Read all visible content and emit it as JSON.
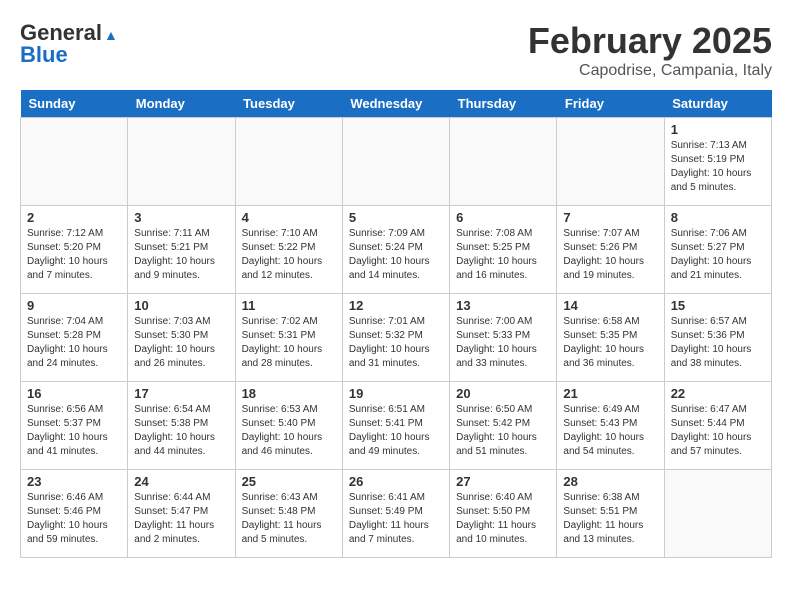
{
  "header": {
    "logo_general": "General",
    "logo_blue": "Blue",
    "title": "February 2025",
    "location": "Capodrise, Campania, Italy"
  },
  "days_of_week": [
    "Sunday",
    "Monday",
    "Tuesday",
    "Wednesday",
    "Thursday",
    "Friday",
    "Saturday"
  ],
  "weeks": [
    [
      {
        "num": "",
        "info": ""
      },
      {
        "num": "",
        "info": ""
      },
      {
        "num": "",
        "info": ""
      },
      {
        "num": "",
        "info": ""
      },
      {
        "num": "",
        "info": ""
      },
      {
        "num": "",
        "info": ""
      },
      {
        "num": "1",
        "info": "Sunrise: 7:13 AM\nSunset: 5:19 PM\nDaylight: 10 hours and 5 minutes."
      }
    ],
    [
      {
        "num": "2",
        "info": "Sunrise: 7:12 AM\nSunset: 5:20 PM\nDaylight: 10 hours and 7 minutes."
      },
      {
        "num": "3",
        "info": "Sunrise: 7:11 AM\nSunset: 5:21 PM\nDaylight: 10 hours and 9 minutes."
      },
      {
        "num": "4",
        "info": "Sunrise: 7:10 AM\nSunset: 5:22 PM\nDaylight: 10 hours and 12 minutes."
      },
      {
        "num": "5",
        "info": "Sunrise: 7:09 AM\nSunset: 5:24 PM\nDaylight: 10 hours and 14 minutes."
      },
      {
        "num": "6",
        "info": "Sunrise: 7:08 AM\nSunset: 5:25 PM\nDaylight: 10 hours and 16 minutes."
      },
      {
        "num": "7",
        "info": "Sunrise: 7:07 AM\nSunset: 5:26 PM\nDaylight: 10 hours and 19 minutes."
      },
      {
        "num": "8",
        "info": "Sunrise: 7:06 AM\nSunset: 5:27 PM\nDaylight: 10 hours and 21 minutes."
      }
    ],
    [
      {
        "num": "9",
        "info": "Sunrise: 7:04 AM\nSunset: 5:28 PM\nDaylight: 10 hours and 24 minutes."
      },
      {
        "num": "10",
        "info": "Sunrise: 7:03 AM\nSunset: 5:30 PM\nDaylight: 10 hours and 26 minutes."
      },
      {
        "num": "11",
        "info": "Sunrise: 7:02 AM\nSunset: 5:31 PM\nDaylight: 10 hours and 28 minutes."
      },
      {
        "num": "12",
        "info": "Sunrise: 7:01 AM\nSunset: 5:32 PM\nDaylight: 10 hours and 31 minutes."
      },
      {
        "num": "13",
        "info": "Sunrise: 7:00 AM\nSunset: 5:33 PM\nDaylight: 10 hours and 33 minutes."
      },
      {
        "num": "14",
        "info": "Sunrise: 6:58 AM\nSunset: 5:35 PM\nDaylight: 10 hours and 36 minutes."
      },
      {
        "num": "15",
        "info": "Sunrise: 6:57 AM\nSunset: 5:36 PM\nDaylight: 10 hours and 38 minutes."
      }
    ],
    [
      {
        "num": "16",
        "info": "Sunrise: 6:56 AM\nSunset: 5:37 PM\nDaylight: 10 hours and 41 minutes."
      },
      {
        "num": "17",
        "info": "Sunrise: 6:54 AM\nSunset: 5:38 PM\nDaylight: 10 hours and 44 minutes."
      },
      {
        "num": "18",
        "info": "Sunrise: 6:53 AM\nSunset: 5:40 PM\nDaylight: 10 hours and 46 minutes."
      },
      {
        "num": "19",
        "info": "Sunrise: 6:51 AM\nSunset: 5:41 PM\nDaylight: 10 hours and 49 minutes."
      },
      {
        "num": "20",
        "info": "Sunrise: 6:50 AM\nSunset: 5:42 PM\nDaylight: 10 hours and 51 minutes."
      },
      {
        "num": "21",
        "info": "Sunrise: 6:49 AM\nSunset: 5:43 PM\nDaylight: 10 hours and 54 minutes."
      },
      {
        "num": "22",
        "info": "Sunrise: 6:47 AM\nSunset: 5:44 PM\nDaylight: 10 hours and 57 minutes."
      }
    ],
    [
      {
        "num": "23",
        "info": "Sunrise: 6:46 AM\nSunset: 5:46 PM\nDaylight: 10 hours and 59 minutes."
      },
      {
        "num": "24",
        "info": "Sunrise: 6:44 AM\nSunset: 5:47 PM\nDaylight: 11 hours and 2 minutes."
      },
      {
        "num": "25",
        "info": "Sunrise: 6:43 AM\nSunset: 5:48 PM\nDaylight: 11 hours and 5 minutes."
      },
      {
        "num": "26",
        "info": "Sunrise: 6:41 AM\nSunset: 5:49 PM\nDaylight: 11 hours and 7 minutes."
      },
      {
        "num": "27",
        "info": "Sunrise: 6:40 AM\nSunset: 5:50 PM\nDaylight: 11 hours and 10 minutes."
      },
      {
        "num": "28",
        "info": "Sunrise: 6:38 AM\nSunset: 5:51 PM\nDaylight: 11 hours and 13 minutes."
      },
      {
        "num": "",
        "info": ""
      }
    ]
  ]
}
